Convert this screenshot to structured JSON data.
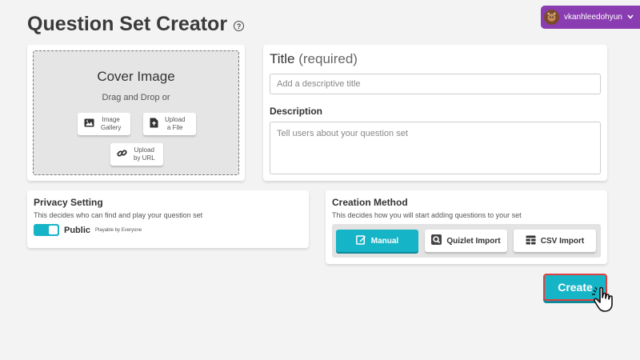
{
  "header": {
    "title": "Question Set Creator",
    "help_glyph": "?",
    "username": "vkanhleedohyun",
    "user_pill_color": "#8a3db0"
  },
  "cover": {
    "title": "Cover Image",
    "subtitle": "Drag and Drop or",
    "buttons": {
      "gallery_line1": "Image",
      "gallery_line2": "Gallery",
      "upload_line1": "Upload",
      "upload_line2": "a File",
      "url_line1": "Upload",
      "url_line2": "by URL"
    }
  },
  "title_form": {
    "title_label": "Title",
    "title_required": "(required)",
    "title_placeholder": "Add a descriptive title",
    "description_label": "Description",
    "description_placeholder": "Tell users about your question set"
  },
  "privacy": {
    "heading": "Privacy Setting",
    "subtitle": "This decides who can find and play your question set",
    "toggle_label": "Public",
    "toggle_sublabel": "Playable by Everyone",
    "toggle_on": true
  },
  "method": {
    "heading": "Creation Method",
    "subtitle": "This decides how you will start adding questions to your set",
    "options": [
      {
        "label": "Manual",
        "active": true
      },
      {
        "label": "Quizlet Import",
        "active": false
      },
      {
        "label": "CSV Import",
        "active": false
      }
    ]
  },
  "actions": {
    "create_label": "Create"
  },
  "colors": {
    "accent": "#16b4c7",
    "create_border": "#e04040"
  }
}
